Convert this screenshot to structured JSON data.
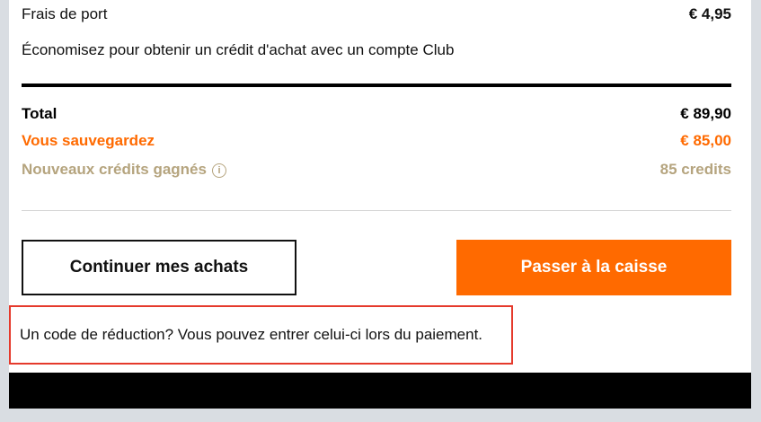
{
  "colors": {
    "accent_orange": "#ff6a00",
    "credits_khaki": "#b5a47e",
    "promo_border_red": "#e53a2c"
  },
  "shipping": {
    "label": "Frais de port",
    "value": "€ 4,95"
  },
  "club_note": "Économisez pour obtenir un crédit d'achat avec un compte Club",
  "summary": {
    "total_label": "Total",
    "total_value": "€ 89,90",
    "savings_label": "Vous sauvegardez",
    "savings_value": "€ 85,00",
    "credits_label": "Nouveaux crédits gagnés",
    "credits_value": "85 credits",
    "credits_info_icon": "info-icon"
  },
  "buttons": {
    "continue_label": "Continuer mes achats",
    "checkout_label": "Passer à la caisse"
  },
  "promo_note": "Un code de réduction? Vous pouvez entrer celui-ci lors du paiement."
}
